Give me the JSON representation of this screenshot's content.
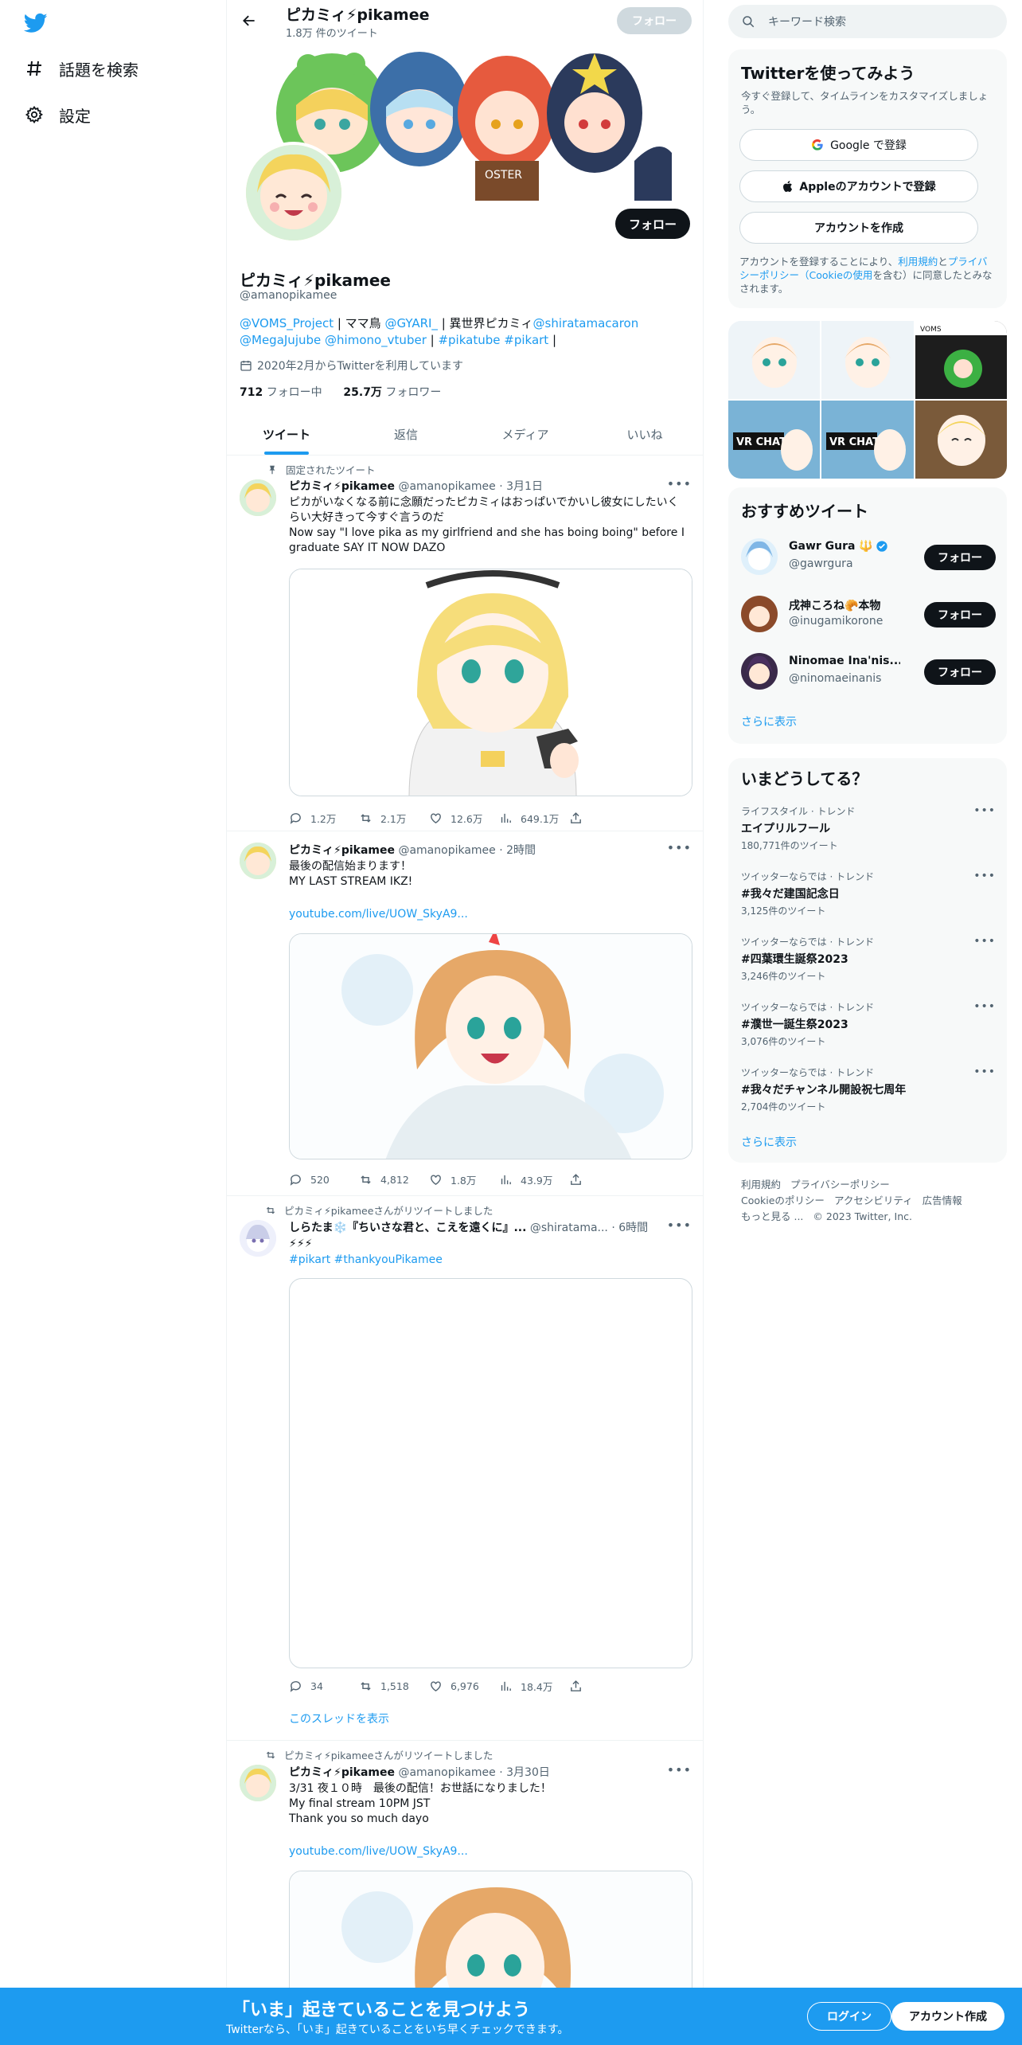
{
  "nav": {
    "explore_label": "話題を検索",
    "settings_label": "設定"
  },
  "header": {
    "name": "ピカミィ⚡pikamee",
    "tweet_count": "1.8万 件のツイート",
    "follow_label": "フォロー"
  },
  "profile": {
    "name": "ピカミィ⚡pikamee",
    "handle": "@amanopikamee",
    "follow_label": "フォロー",
    "bio_parts": [
      "@VOMS_Project",
      " | ママ鳥 ",
      "@GYARI_",
      " | 異世界ピカミィ",
      "@shiratamacaron",
      "@MegaJujube",
      " ",
      "@himono_vtuber",
      " | ",
      "#pikatube",
      " ",
      "#pikart",
      " |"
    ],
    "joined": "2020年2月からTwitterを利用しています",
    "following_count": "712",
    "following_label": "フォロー中",
    "followers_count": "25.7万",
    "followers_label": "フォロワー"
  },
  "tabs": [
    "ツイート",
    "返信",
    "メディア",
    "いいね"
  ],
  "tweets": [
    {
      "context": "固定されたツイート",
      "name": "ピカミィ⚡pikamee",
      "handle": "@amanopikamee",
      "time": "3月1日",
      "text": "ピカがいなくなる前に念願だったピカミィはおっぱいでかいし彼女にしたいくらい大好きって今すぐ言うのだ\nNow say \"I love pika as my girlfriend and she has boing boing\" before I graduate SAY IT NOW DAZO",
      "link": "",
      "hashtags": "",
      "replies": "1.2万",
      "retweets": "2.1万",
      "likes": "12.6万",
      "views": "649.1万"
    },
    {
      "context": "",
      "name": "ピカミィ⚡pikamee",
      "handle": "@amanopikamee",
      "time": "2時間",
      "text": "最後の配信始まります！\nMY LAST STREAM IKZ!",
      "link": "youtube.com/live/UOW_SkyA9...",
      "hashtags": "",
      "replies": "520",
      "retweets": "4,812",
      "likes": "1.8万",
      "views": "43.9万"
    },
    {
      "context": "ピカミィ⚡pikameeさんがリツイートしました",
      "name": "しらたま❄️『ちいさな君と、こえを遠くに』...",
      "handle": "@shiratama...",
      "time": "6時間",
      "text": "⚡⚡⚡",
      "link": "",
      "hashtags": "#pikart #thankyouPikamee",
      "replies": "34",
      "retweets": "1,518",
      "likes": "6,976",
      "views": "18.4万",
      "thread_label": "このスレッドを表示"
    },
    {
      "context": "ピカミィ⚡pikameeさんがリツイートしました",
      "name": "ピカミィ⚡pikamee",
      "handle": "@amanopikamee",
      "time": "3月30日",
      "text": "3/31 夜１０時　最後の配信！お世話になりました！\nMy final stream 10PM JST\nThank you so much dayo",
      "link": "youtube.com/live/UOW_SkyA9..."
    }
  ],
  "sidebar": {
    "search_placeholder": "キーワード検索",
    "signup_title": "Twitterを使ってみよう",
    "signup_sub": "今すぐ登録して、タイムラインをカスタマイズしましょう。",
    "google_label": "Google で登録",
    "apple_label": "Appleのアカウントで登録",
    "create_label": "アカウントを作成",
    "legal_parts": [
      "アカウントを登録することにより、",
      "利用規約",
      "と",
      "プライバシーポリシー（Cookieの使用",
      "を含む）に同意したとみなされます。"
    ],
    "recommend_title": "おすすめツイート",
    "recommend": [
      {
        "name": "Gawr Gura 🔱",
        "handle": "@gawrgura",
        "verified": true,
        "follow": "フォロー"
      },
      {
        "name": "戌神ころね🥐本物",
        "handle": "@inugamikorone",
        "verified": false,
        "follow": "フォロー"
      },
      {
        "name": "Ninomae Ina'nis...",
        "handle": "@ninomaeinanis",
        "verified": true,
        "follow": "フォロー"
      }
    ],
    "show_more": "さらに表示",
    "trends_title": "いまどうしてる？",
    "trends": [
      {
        "context": "ライフスタイル · トレンド",
        "title": "エイプリルフール",
        "count": "180,771件のツイート"
      },
      {
        "context": "ツイッターならでは · トレンド",
        "title": "#我々だ建国記念日",
        "count": "3,125件のツイート"
      },
      {
        "context": "ツイッターならでは · トレンド",
        "title": "#四葉環生誕祭2023",
        "count": "3,246件のツイート"
      },
      {
        "context": "ツイッターならでは · トレンド",
        "title": "#濮世一誕生祭2023",
        "count": "3,076件のツイート"
      },
      {
        "context": "ツイッターならでは · トレンド",
        "title": "#我々だチャンネル開設祝七周年",
        "count": "2,704件のツイート"
      }
    ],
    "footer": [
      "利用規約",
      "プライバシーポリシー",
      "Cookieのポリシー",
      "アクセシビリティ",
      "広告情報",
      "もっと見る ...",
      "© 2023 Twitter, Inc."
    ]
  },
  "bottom": {
    "title": "「いま」起きていることを見つけよう",
    "subtitle": "Twitterなら、「いま」起きていることをいち早くチェックできます。",
    "login": "ログイン",
    "signup": "アカウント作成"
  },
  "colors": {
    "accent": "#1d9bf0",
    "dark": "#0f1419",
    "muted": "#536471"
  }
}
